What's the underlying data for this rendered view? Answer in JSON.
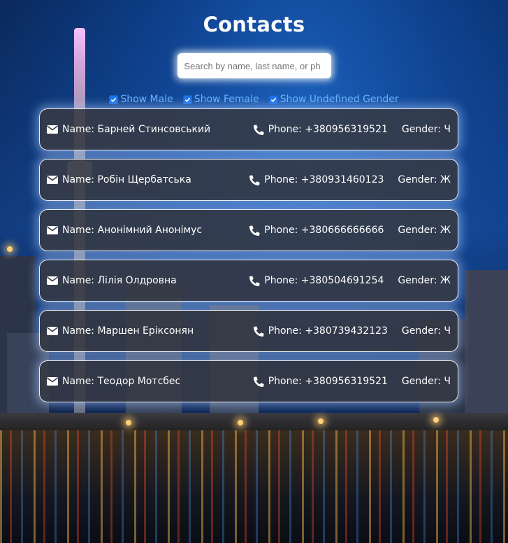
{
  "page": {
    "title": "Contacts"
  },
  "search": {
    "placeholder": "Search by name, last name, or ph",
    "value": ""
  },
  "filters": [
    {
      "label": "Show Male",
      "checked": true
    },
    {
      "label": "Show Female",
      "checked": true
    },
    {
      "label": "Show Undefined Gender",
      "checked": true
    }
  ],
  "contacts": [
    {
      "name": "Name: Барней Стинсовський",
      "phone": "Phone: +380956319521",
      "gender": "Gender: Ч"
    },
    {
      "name": "Name: Робін Щербатська",
      "phone": "Phone: +380931460123",
      "gender": "Gender: Ж"
    },
    {
      "name": "Name: Анонімний Анонімус",
      "phone": "Phone: +380666666666",
      "gender": "Gender: Ж"
    },
    {
      "name": "Name: Лілія Олдровна",
      "phone": "Phone: +380504691254",
      "gender": "Gender: Ж"
    },
    {
      "name": "Name: Маршен Еріксонян",
      "phone": "Phone: +380739432123",
      "gender": "Gender: Ч"
    },
    {
      "name": "Name: Теодор Мотсбес",
      "phone": "Phone: +380956319521",
      "gender": "Gender: Ч"
    }
  ],
  "icons": {
    "email": "envelope-icon",
    "phone": "phone-icon",
    "checkbox": "checkmark-icon"
  },
  "colors": {
    "filter_text": "#66b3ff",
    "checkbox_fill": "#1a73e8",
    "card_background": "#373a44",
    "card_text": "#ffffff",
    "title_text": "#ffffff"
  }
}
